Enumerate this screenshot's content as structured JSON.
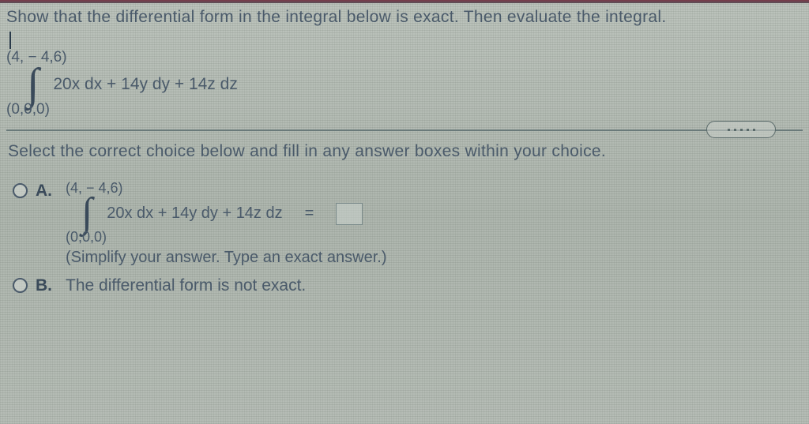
{
  "question": {
    "prompt": "Show that the differential form in the integral below is exact. Then evaluate the integral.",
    "integral": {
      "upper_limit": "(4, − 4,6)",
      "lower_limit": "(0,0,0)",
      "integrand": "20x dx + 14y dy + 14z dz"
    }
  },
  "instruction": "Select the correct choice below and fill in any answer boxes within your choice.",
  "choices": {
    "a": {
      "label": "A.",
      "upper_limit": "(4, − 4,6)",
      "lower_limit": "(0,0,0)",
      "integrand": "20x dx + 14y dy + 14z dz",
      "equals": "=",
      "hint": "(Simplify your answer. Type an exact answer.)"
    },
    "b": {
      "label": "B.",
      "text": "The differential form is not exact."
    }
  }
}
